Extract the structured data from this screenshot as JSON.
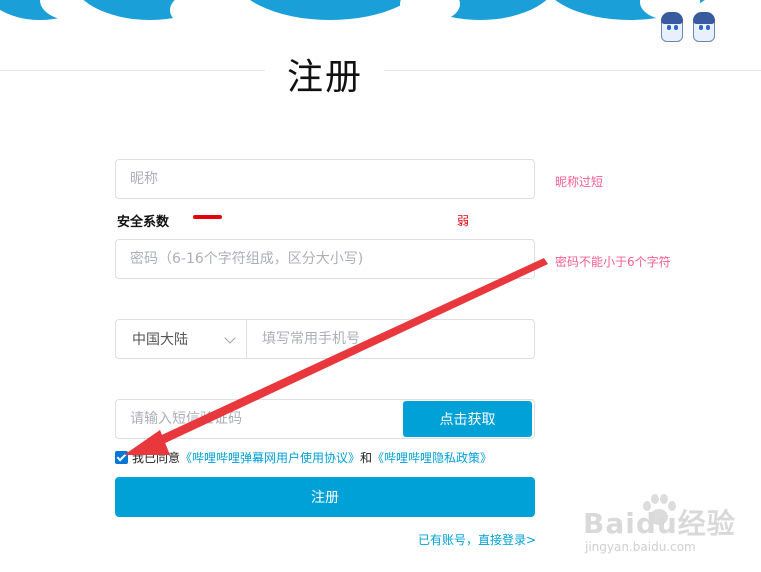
{
  "header": {
    "title": "注册"
  },
  "nickname": {
    "placeholder": "昵称",
    "hint": "昵称过短"
  },
  "security": {
    "label": "安全系数",
    "level": "弱",
    "strength": 0.25
  },
  "password": {
    "placeholder": "密码（6-16个字符组成，区分大小写)",
    "hint": "密码不能小于6个字符"
  },
  "phone": {
    "region": "中国大陆",
    "placeholder": "填写常用手机号"
  },
  "sms": {
    "placeholder": "请输入短信验证码",
    "button_label": "点击获取"
  },
  "agreement": {
    "checked": true,
    "prefix": "我已同意",
    "link1": "《哔哩哔哩弹幕网用户使用协议》",
    "and": "和",
    "link2": "《哔哩哔哩隐私政策》"
  },
  "register_button": "注册",
  "login_link": "已有账号，直接登录>",
  "watermark": {
    "brand": "Baidu经验",
    "url": "jingyan.baidu.com"
  },
  "colors": {
    "accent": "#00a1d6",
    "error": "#f25d8e",
    "weak": "#e4000f",
    "annotation_arrow": "#e8383d"
  }
}
